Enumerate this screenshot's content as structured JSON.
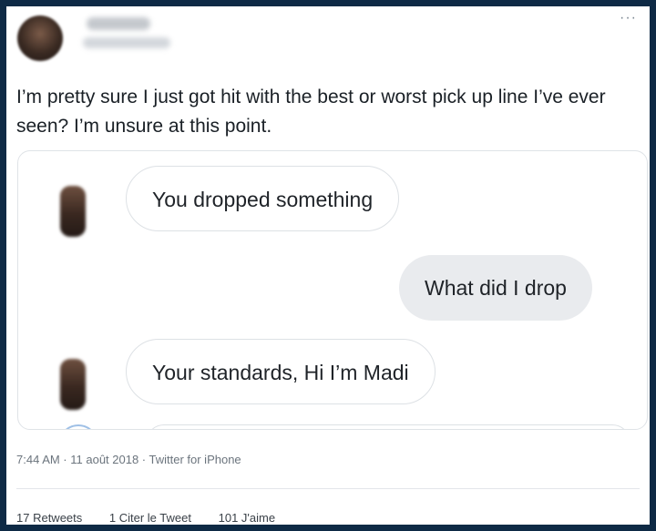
{
  "tweet": {
    "text": "I’m pretty sure I just got hit with the best or worst pick up line I’ve ever seen? I’m unsure at this point.",
    "more_icon": "more-icon"
  },
  "conversation": [
    {
      "side": "incoming",
      "text": "You dropped something"
    },
    {
      "side": "outgoing",
      "text": "What did I drop"
    },
    {
      "side": "incoming",
      "text": "Your standards, Hi I’m Madi"
    }
  ],
  "meta": {
    "timestamp": "7:44 AM · 11 août 2018 · Twitter for iPhone"
  },
  "stats": {
    "retweets": "17 Retweets",
    "quotes": "1 Citer le Tweet",
    "likes": "101 J'aime"
  },
  "colors": {
    "frame": "#0e2a45",
    "outgoing_bubble": "#e9ebee",
    "text": "#1a2026"
  }
}
